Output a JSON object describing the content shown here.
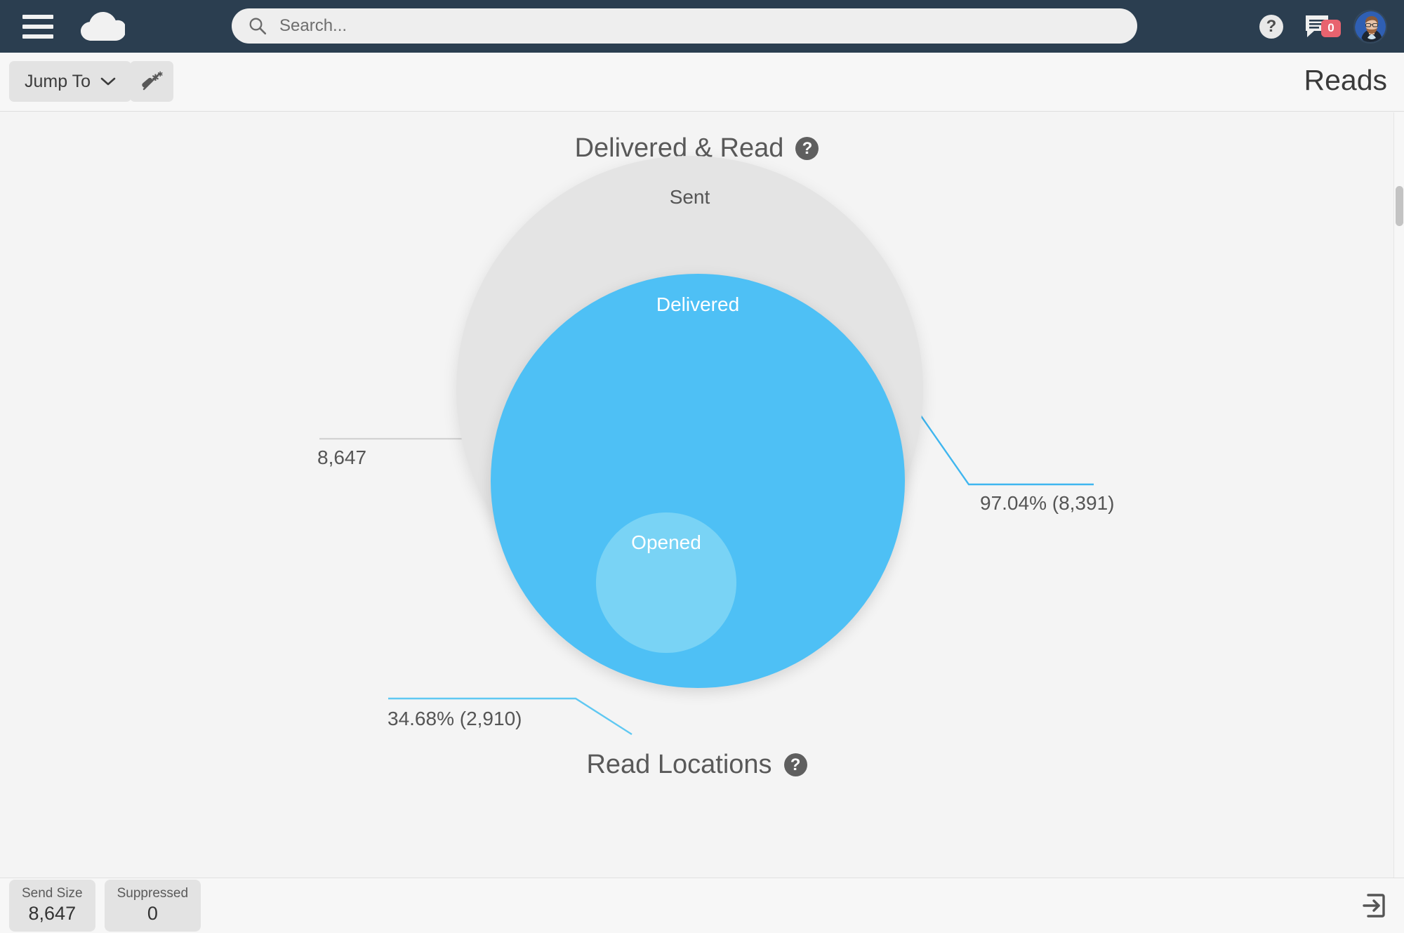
{
  "topnav": {
    "menu_icon": "hamburger-menu-icon",
    "logo_icon": "cloud-logo-icon",
    "search": {
      "value": "",
      "placeholder": "Search..."
    },
    "help_label": "?",
    "chat_badge_count": "0",
    "avatar_alt": "user-avatar"
  },
  "toolbar": {
    "jump_to_label": "Jump To",
    "wand_icon": "magic-wand-icon",
    "page_title": "Reads"
  },
  "main": {
    "chart_title": "Delivered & Read",
    "chart_help": "?",
    "section2_title": "Read Locations",
    "section2_help": "?"
  },
  "footer": {
    "stats": [
      {
        "label": "Send Size",
        "value": "8,647"
      },
      {
        "label": "Suppressed",
        "value": "0"
      }
    ],
    "export_icon": "export-arrow-icon"
  },
  "chart_data": {
    "type": "pie",
    "title": "Delivered & Read",
    "variant": "nested-proportional-circles",
    "categories": [
      "Sent",
      "Delivered",
      "Opened"
    ],
    "values": [
      8647,
      8391,
      2910
    ],
    "labels": [
      "Sent",
      "Delivered",
      "Opened"
    ],
    "value_labels": [
      "8,647",
      "97.04% (8,391)",
      "34.68% (2,910)"
    ],
    "percentages": [
      100,
      97.04,
      34.68
    ],
    "colors": [
      "#e4e4e4",
      "#4ec0f5",
      "#79d3f5"
    ],
    "label_text_colors": [
      "#555555",
      "#ffffff",
      "#ffffff"
    ],
    "leader_line_colors": [
      "#cfcfcf",
      "#3fb6ef",
      "#5fc8f2"
    ],
    "legend": "none",
    "grid": false,
    "series": [
      {
        "name": "Sent",
        "value": 8647,
        "display": "8,647",
        "percent_of_sent": 100.0
      },
      {
        "name": "Delivered",
        "value": 8391,
        "display": "97.04% (8,391)",
        "percent_of_sent": 97.04
      },
      {
        "name": "Opened",
        "value": 2910,
        "display": "34.68% (2,910)",
        "percent_of_sent": 34.68
      }
    ]
  }
}
